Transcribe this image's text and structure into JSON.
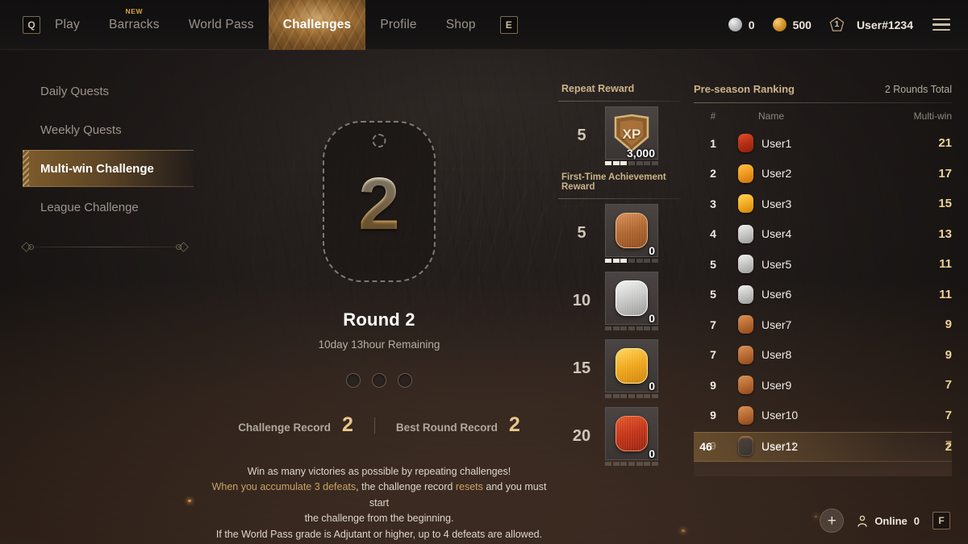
{
  "topnav": {
    "left_key": "Q",
    "right_key": "E",
    "items": [
      {
        "label": "Play",
        "badge": "",
        "active": false
      },
      {
        "label": "Barracks",
        "badge": "NEW",
        "active": false
      },
      {
        "label": "World Pass",
        "badge": "",
        "active": false
      },
      {
        "label": "Challenges",
        "badge": "",
        "active": true
      },
      {
        "label": "Profile",
        "badge": "",
        "active": false
      },
      {
        "label": "Shop",
        "badge": "",
        "active": false
      }
    ],
    "currency_silver": "0",
    "currency_gold": "500",
    "player_level": "1",
    "player_name": "User#1234",
    "menu_icon": "hamburger-menu-icon"
  },
  "sidebar": {
    "items": [
      {
        "label": "Daily Quests",
        "active": false
      },
      {
        "label": "Weekly Quests",
        "active": false
      },
      {
        "label": "Multi-win Challenge",
        "active": true
      },
      {
        "label": "League Challenge",
        "active": false
      }
    ]
  },
  "center": {
    "round_number": "2",
    "round_title": "Round 2",
    "time_remaining": "10day 13hour Remaining",
    "defeat_slots": 3,
    "challenge_record_label": "Challenge Record",
    "challenge_record_value": "2",
    "best_round_record_label": "Best Round Record",
    "best_round_record_value": "2",
    "desc_line1": "Win as many victories as possible by repeating challenges!",
    "desc_line2_a": "When you accumulate 3 defeats",
    "desc_line2_b": ", the challenge record ",
    "desc_line2_c": "resets",
    "desc_line2_d": " and you must start",
    "desc_line3": "the challenge from the beginning.",
    "desc_line4": "If the World Pass grade is Adjutant or higher, up to 4 defeats are allowed."
  },
  "rewards": {
    "repeat_header": "Repeat Reward",
    "firsttime_header": "First-Time Achievement Reward",
    "repeat_items": [
      {
        "count": "5",
        "icon": "xp-badge-icon",
        "kind": "xp",
        "qty": "3,000",
        "segments": 7,
        "filled": 3
      }
    ],
    "firsttime_items": [
      {
        "count": "5",
        "icon": "bronze-medal-icon",
        "kind": "bronze",
        "qty": "0",
        "segments": 7,
        "filled": 3
      },
      {
        "count": "10",
        "icon": "silver-medal-icon",
        "kind": "silver",
        "qty": "0",
        "segments": 7,
        "filled": 0
      },
      {
        "count": "15",
        "icon": "gold-medal-icon",
        "kind": "gold",
        "qty": "0",
        "segments": 7,
        "filled": 0
      },
      {
        "count": "20",
        "icon": "red-medal-icon",
        "kind": "red",
        "qty": "0",
        "segments": 7,
        "filled": 0
      }
    ]
  },
  "ranking": {
    "title": "Pre-season Ranking",
    "rounds_total": "2 Rounds Total",
    "columns": {
      "rank": "#",
      "name": "Name",
      "wins": "Multi-win"
    },
    "rows": [
      {
        "rank": "1",
        "name": "User1",
        "wins": "21",
        "tier": "red"
      },
      {
        "rank": "2",
        "name": "User2",
        "wins": "17",
        "tier": "orange"
      },
      {
        "rank": "3",
        "name": "User3",
        "wins": "15",
        "tier": "gold"
      },
      {
        "rank": "4",
        "name": "User4",
        "wins": "13",
        "tier": "silver"
      },
      {
        "rank": "5",
        "name": "User5",
        "wins": "11",
        "tier": "silver"
      },
      {
        "rank": "5",
        "name": "User6",
        "wins": "11",
        "tier": "silver"
      },
      {
        "rank": "7",
        "name": "User7",
        "wins": "9",
        "tier": "bronze"
      },
      {
        "rank": "7",
        "name": "User8",
        "wins": "9",
        "tier": "bronze"
      },
      {
        "rank": "9",
        "name": "User9",
        "wins": "7",
        "tier": "bronze"
      },
      {
        "rank": "9",
        "name": "User10",
        "wins": "7",
        "tier": "bronze"
      },
      {
        "rank": "9",
        "name": "User11",
        "wins": "7",
        "tier": "bronze"
      }
    ],
    "my_row": {
      "rank": "46",
      "name": "User12",
      "wins": "2",
      "tier": "none"
    }
  },
  "bottombar": {
    "add_label": "+",
    "online_label": "Online",
    "online_count": "0",
    "friends_key": "F"
  },
  "colors": {
    "accent_gold": "#cbb488",
    "highlight": "#d6b070",
    "value_gold": "#ecd295",
    "text_primary": "#f0ece4",
    "text_muted": "#9c948b"
  }
}
